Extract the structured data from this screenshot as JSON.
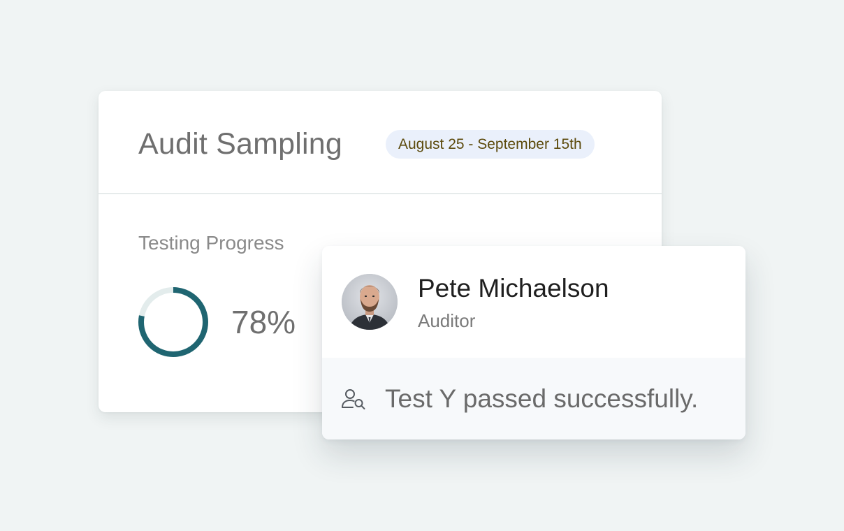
{
  "audit": {
    "title": "Audit Sampling",
    "date_range": "August 25 - September 15th",
    "progress_label": "Testing Progress",
    "progress_percent": 78,
    "progress_text": "78%",
    "colors": {
      "ring": "#1f6571",
      "ring_track": "#e3ecec",
      "badge_bg": "#eaf0fb"
    }
  },
  "notification": {
    "avatar_icon": "user-photo-avatar",
    "name": "Pete Michaelson",
    "role": "Auditor",
    "message_icon": "user-search-icon",
    "message": "Test Y passed successfully."
  }
}
